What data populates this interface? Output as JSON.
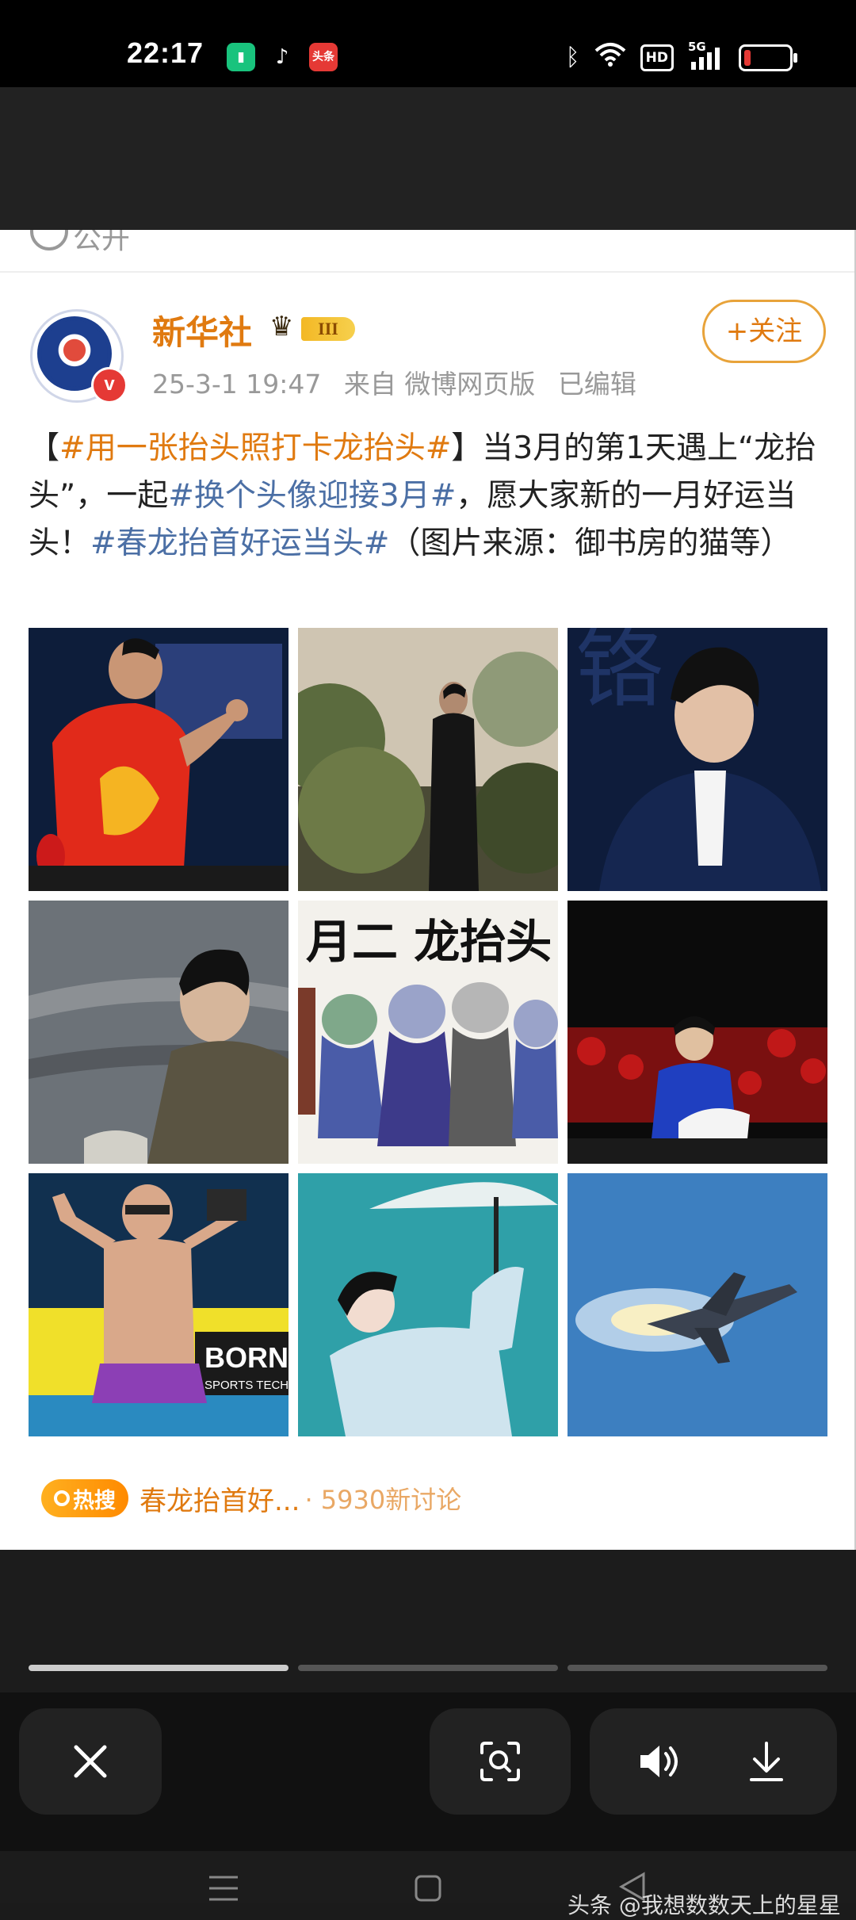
{
  "status_bar": {
    "time": "22:17",
    "apps": [
      "battery-saver-icon",
      "douyin-icon",
      "toutiao-icon"
    ],
    "toutiao_label": "头条",
    "hd_label": "HD",
    "network_label": "5G"
  },
  "previous_post": {
    "visibility_label": "公开"
  },
  "post": {
    "author": "新华社",
    "level_badge": "III",
    "date": "25-3-1 19:47",
    "source": "来自 微博网页版",
    "edited": "已编辑",
    "follow_label": "+关注",
    "text": {
      "open_bracket": "【",
      "tag1": "#用一张抬头照打卡龙抬头#",
      "part1": "】当3月的第1天遇上“龙抬头”，一起",
      "tag2": "#换个头像迎接3月#",
      "part2": "，愿大家新的一月好运当头！",
      "tag3": "#春龙抬首好运当头#",
      "part3": "（图片来源：御书房的猫等）"
    },
    "images": [
      {
        "name": "table-tennis-player-red-jersey"
      },
      {
        "name": "man-standing-in-garden"
      },
      {
        "name": "man-in-suit-smiling"
      },
      {
        "name": "man-lying-on-ground"
      },
      {
        "name": "cartoon-dragon-characters"
      },
      {
        "name": "table-tennis-player-blue-jersey"
      },
      {
        "name": "swimmer-celebrating"
      },
      {
        "name": "opera-performer-with-umbrella"
      },
      {
        "name": "fighter-jet-in-sky"
      }
    ],
    "drawing_text": "月二  龙抬头",
    "pool_sign": "BORN",
    "pool_sign_sub": "SPORTS TECH",
    "hot_search": {
      "badge": "热搜",
      "topic": "春龙抬首好...",
      "count": "· 5930新讨论"
    }
  },
  "viewer": {
    "progress_segments": 3,
    "active_segment": 0,
    "close_icon": "close-icon",
    "scan_icon": "scan-icon",
    "volume_icon": "volume-icon",
    "download_icon": "download-icon"
  },
  "nav_bar": {
    "caption": "头条 @我想数数天上的星星"
  }
}
